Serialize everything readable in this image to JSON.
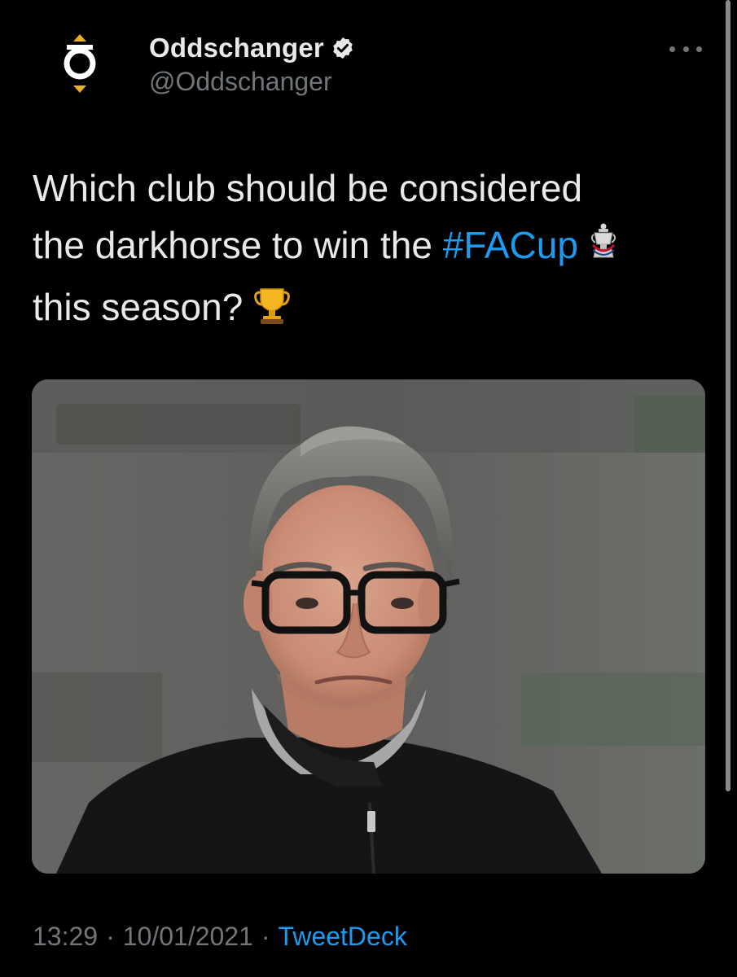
{
  "author": {
    "display_name": "Oddschanger",
    "handle": "@Oddschanger",
    "verified": true,
    "avatar_icon": "oddschanger-logo-icon"
  },
  "menu": {
    "icon": "more-horizontal-icon"
  },
  "tweet": {
    "text_line1": "Which club should be considered",
    "text_line2_prefix": "the darkhorse to win the ",
    "hashtag": "#FACup",
    "text_line3": "this season?",
    "emoji_after_hashtag": "fa-cup-trophy-emoji",
    "emoji_end": "trophy-emoji"
  },
  "media": {
    "subject": "photo-of-man-with-glasses-in-black-hooded-jacket"
  },
  "meta": {
    "time": "13:29",
    "date": "10/01/2021",
    "separator": "·",
    "source": "TweetDeck"
  },
  "colors": {
    "background": "#000000",
    "text": "#e7e9ea",
    "secondary": "#71767b",
    "link": "#1d9bf0",
    "brand_gold": "#e8b02a"
  }
}
